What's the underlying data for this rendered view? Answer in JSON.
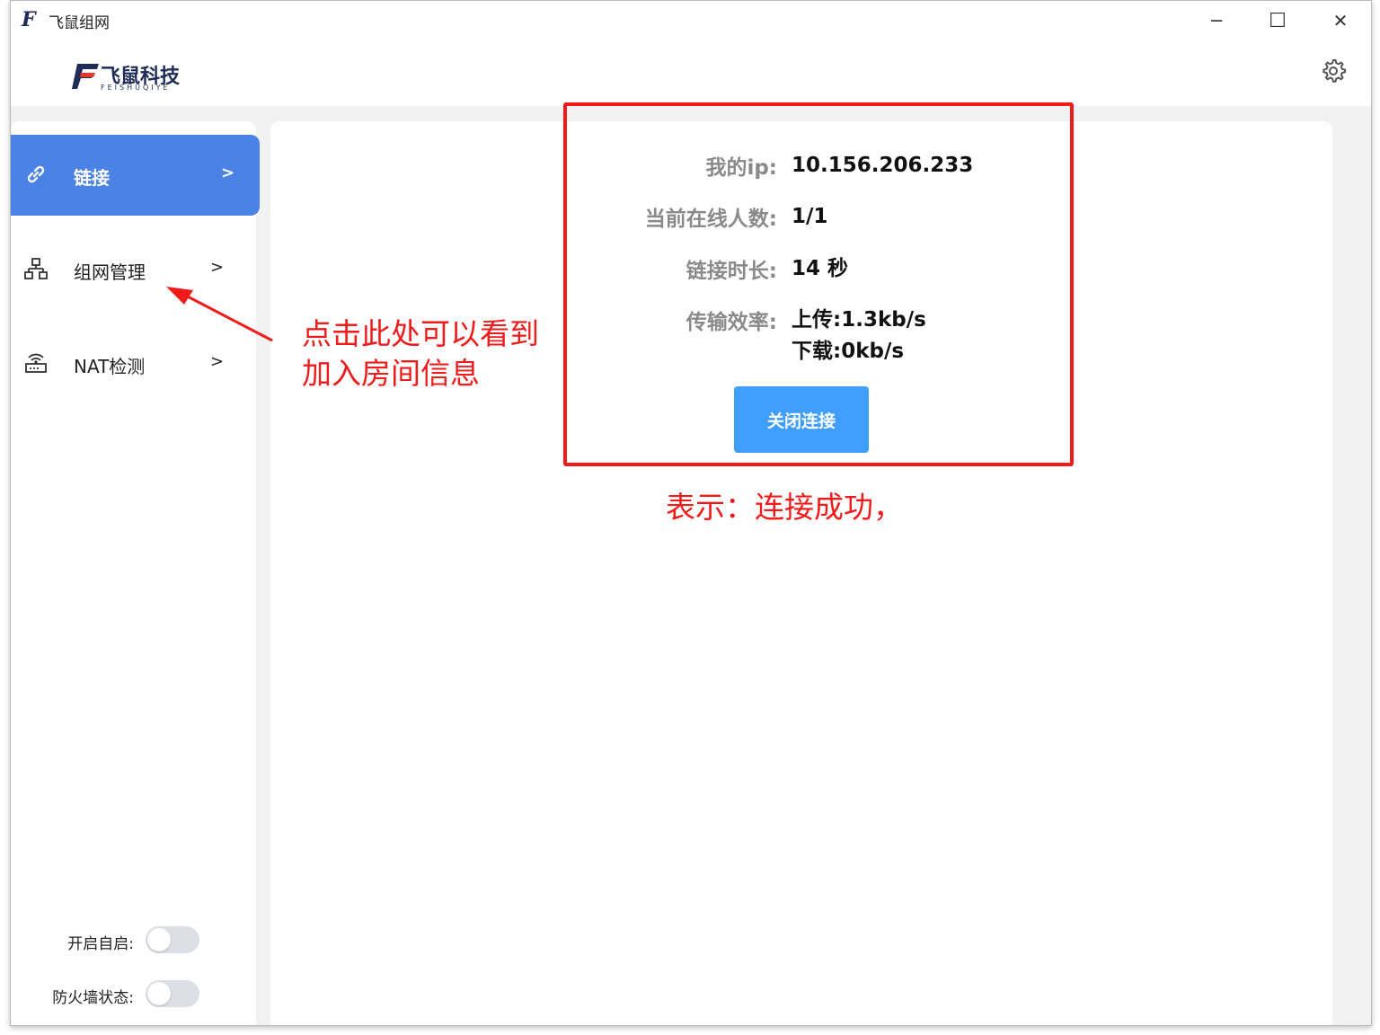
{
  "window": {
    "app_icon_letter": "F",
    "title": "飞鼠组网",
    "minimize_glyph": "─",
    "maximize_glyph": "☐",
    "close_glyph": "✕"
  },
  "header": {
    "logo_text": "飞鼠科技",
    "logo_subtext": "FEISHUQIYE",
    "settings_icon": "gear-icon"
  },
  "sidebar": {
    "items": [
      {
        "label": "链接",
        "icon": "link-icon",
        "arrow": ">",
        "active": true
      },
      {
        "label": "组网管理",
        "icon": "network-icon",
        "arrow": ">",
        "active": false
      },
      {
        "label": "NAT检测",
        "icon": "router-icon",
        "arrow": ">",
        "active": false
      }
    ],
    "toggles": [
      {
        "label": "开启自启:",
        "on": false
      },
      {
        "label": "防火墙状态:",
        "on": false
      }
    ],
    "accent_color": "#4a82e6"
  },
  "connection": {
    "ip_label": "我的ip:",
    "ip_value": "10.156.206.233",
    "online_label": "当前在线人数:",
    "online_value": "1/1",
    "duration_label": "链接时长:",
    "duration_value": "14 秒",
    "rate_label": "传输效率:",
    "upload_value": "上传:1.3kb/s",
    "download_value": "下载:0kb/s",
    "close_button": "关闭连接",
    "button_color": "#409eff"
  },
  "annotations": {
    "note": "点击此处可以看到\n加入房间信息",
    "success": "表示：连接成功，",
    "color": "#f01c1c"
  }
}
